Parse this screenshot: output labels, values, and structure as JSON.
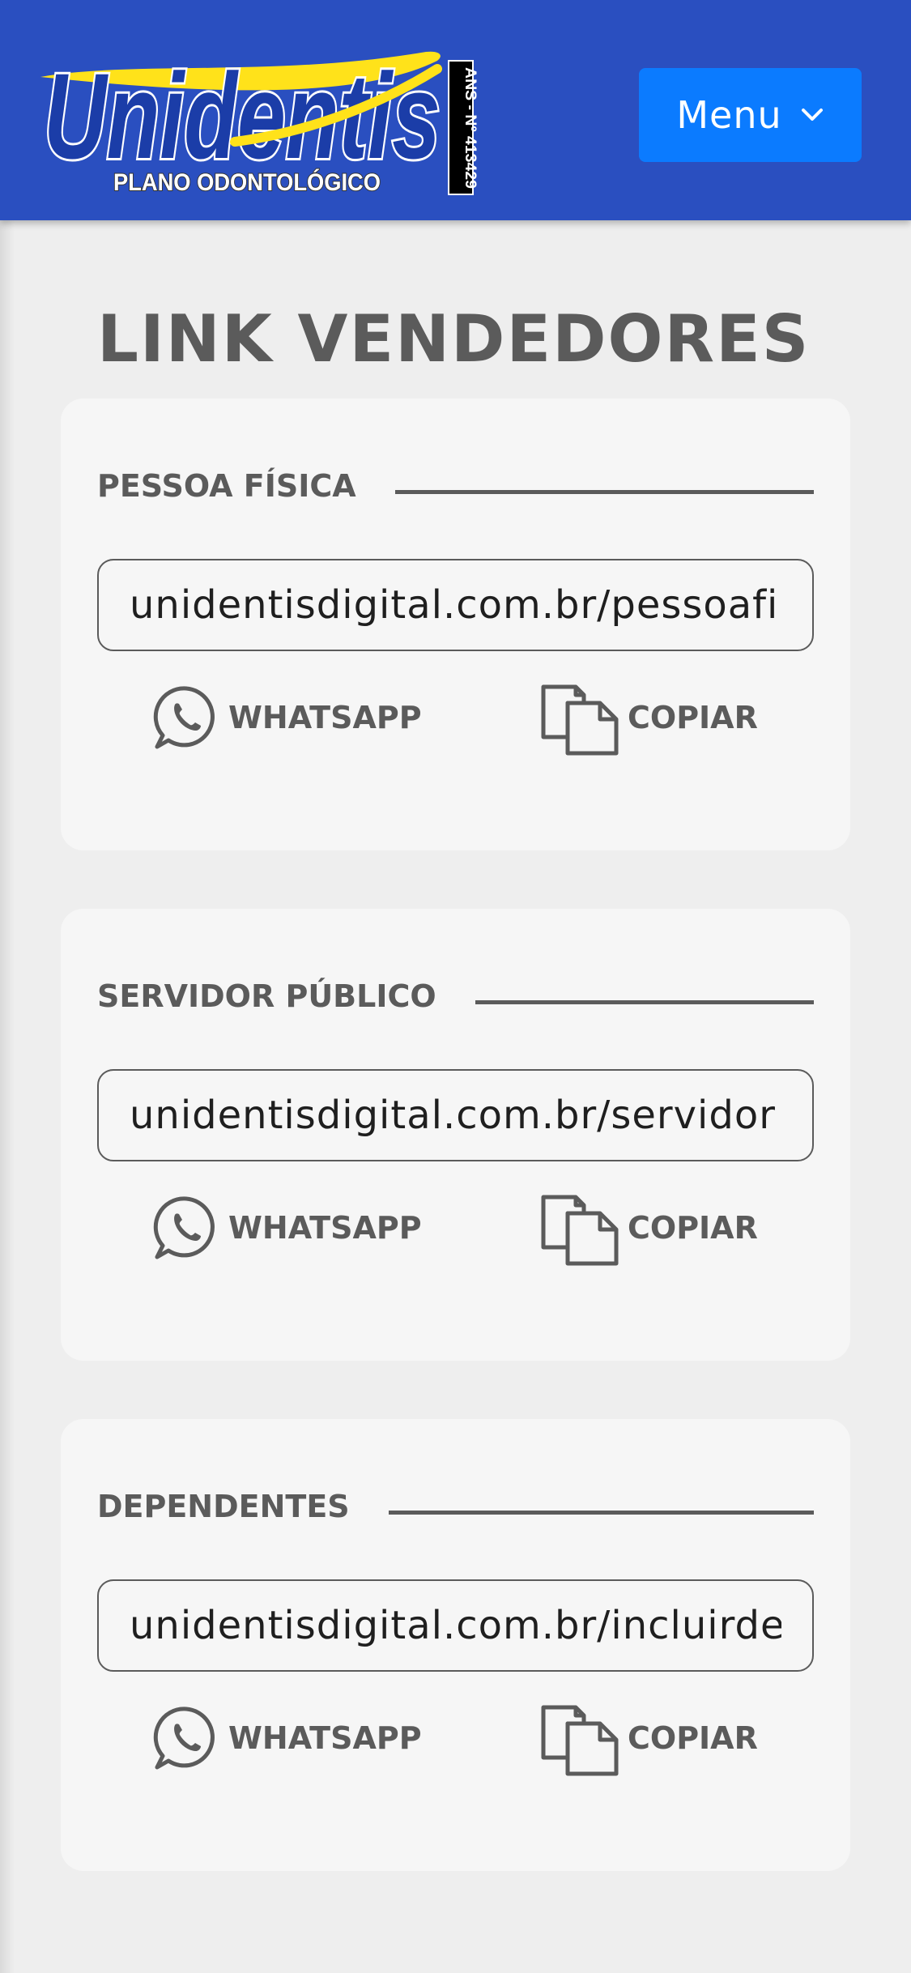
{
  "header": {
    "logo_text": "Unidentis",
    "logo_subtitle": "PLANO ODONTOLÓGICO",
    "logo_registration": "ANS - Nº 413429",
    "menu_label": "Menu",
    "brand_color": "#2a4fc0",
    "button_color": "#0b7bff"
  },
  "page": {
    "title": "LINK VENDEDORES"
  },
  "sections": [
    {
      "title": "PESSOA FÍSICA",
      "url": "unidentisdigital.com.br/pessoafi",
      "whatsapp_label": "WHATSAPP",
      "copy_label": "COPIAR"
    },
    {
      "title": "SERVIDOR PÚBLICO",
      "url": "unidentisdigital.com.br/servidor",
      "whatsapp_label": "WHATSAPP",
      "copy_label": "COPIAR"
    },
    {
      "title": "DEPENDENTES",
      "url": "unidentisdigital.com.br/incluirde",
      "whatsapp_label": "WHATSAPP",
      "copy_label": "COPIAR"
    }
  ],
  "icons": {
    "whatsapp": "whatsapp-icon",
    "copy": "copy-icon",
    "chevron": "chevron-down-icon"
  }
}
